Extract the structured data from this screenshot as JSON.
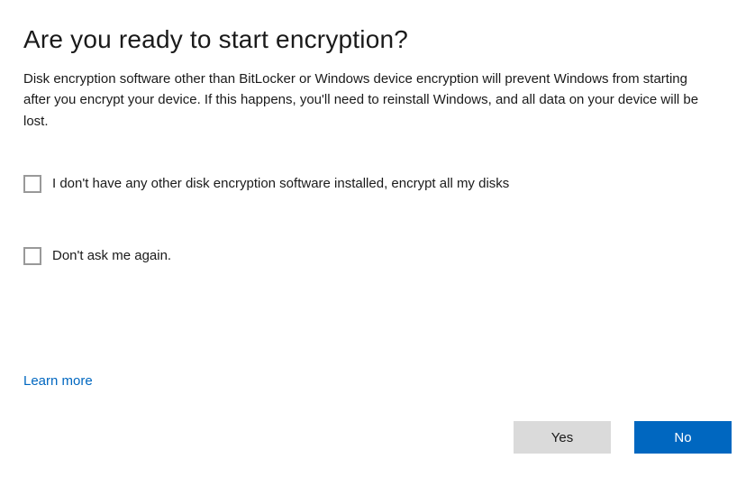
{
  "dialog": {
    "title": "Are you ready to start encryption?",
    "description": "Disk encryption software other than BitLocker or Windows device encryption will prevent Windows from starting after you encrypt your device. If this happens, you'll need to reinstall Windows, and all data on your device will be lost.",
    "checkboxes": [
      {
        "label": "I don't have any other disk encryption software installed, encrypt all my disks",
        "checked": false
      },
      {
        "label": "Don't ask me again.",
        "checked": false
      }
    ],
    "learn_more": "Learn more",
    "buttons": {
      "yes": "Yes",
      "no": "No"
    }
  }
}
